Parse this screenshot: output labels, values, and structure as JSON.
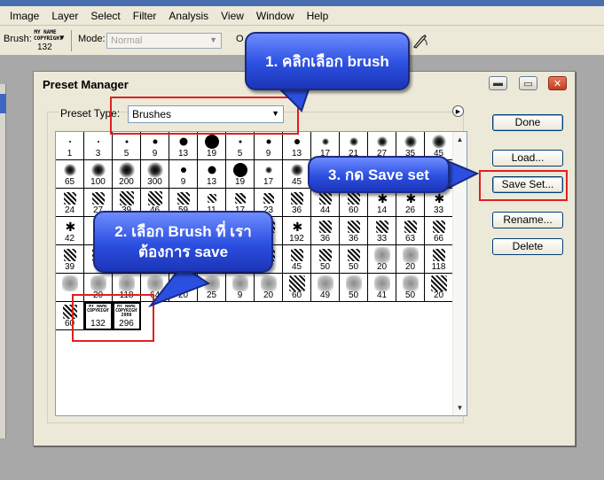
{
  "menubar": [
    "Image",
    "Layer",
    "Select",
    "Filter",
    "Analysis",
    "View",
    "Window",
    "Help"
  ],
  "options": {
    "brush_label": "Brush:",
    "brush_thumb_text": "MY NAME COPYRIGHT",
    "brush_size": "132",
    "mode_label": "Mode:",
    "mode_value": "Normal",
    "opacity_label_partial": "O"
  },
  "dialog": {
    "title": "Preset Manager",
    "preset_type_label": "Preset Type:",
    "preset_type_value": "Brushes",
    "buttons": {
      "done": "Done",
      "load": "Load...",
      "save_set": "Save Set...",
      "rename": "Rename...",
      "delete": "Delete"
    }
  },
  "brushes": [
    {
      "s": "1",
      "k": "hard",
      "d": 2
    },
    {
      "s": "3",
      "k": "hard",
      "d": 2
    },
    {
      "s": "5",
      "k": "hard",
      "d": 3
    },
    {
      "s": "9",
      "k": "hard",
      "d": 5
    },
    {
      "s": "13",
      "k": "hard",
      "d": 9
    },
    {
      "s": "19",
      "k": "hard",
      "d": 16
    },
    {
      "s": "5",
      "k": "hard",
      "d": 3
    },
    {
      "s": "9",
      "k": "hard",
      "d": 5
    },
    {
      "s": "13",
      "k": "hard",
      "d": 6
    },
    {
      "s": "17",
      "k": "soft",
      "d": 8
    },
    {
      "s": "21",
      "k": "soft",
      "d": 10
    },
    {
      "s": "27",
      "k": "soft",
      "d": 12
    },
    {
      "s": "35",
      "k": "soft",
      "d": 14
    },
    {
      "s": "45",
      "k": "soft",
      "d": 16
    },
    {
      "s": "65",
      "k": "soft",
      "d": 14
    },
    {
      "s": "100",
      "k": "soft",
      "d": 16
    },
    {
      "s": "200",
      "k": "soft",
      "d": 18
    },
    {
      "s": "300",
      "k": "soft",
      "d": 18
    },
    {
      "s": "9",
      "k": "hard",
      "d": 6
    },
    {
      "s": "13",
      "k": "hard",
      "d": 9
    },
    {
      "s": "19",
      "k": "hard",
      "d": 16
    },
    {
      "s": "17",
      "k": "soft",
      "d": 8
    },
    {
      "s": "45",
      "k": "soft",
      "d": 14
    },
    {
      "s": "",
      "k": "soft",
      "d": 14
    },
    {
      "s": "",
      "k": "soft",
      "d": 14
    },
    {
      "s": "",
      "k": "soft",
      "d": 14
    },
    {
      "s": "",
      "k": "soft",
      "d": 14
    },
    {
      "s": "",
      "k": "soft",
      "d": 14
    },
    {
      "s": "24",
      "k": "scatter",
      "d": 14
    },
    {
      "s": "27",
      "k": "scatter",
      "d": 14
    },
    {
      "s": "39",
      "k": "scatter",
      "d": 16
    },
    {
      "s": "46",
      "k": "scatter",
      "d": 16
    },
    {
      "s": "59",
      "k": "scatter",
      "d": 14
    },
    {
      "s": "11",
      "k": "scatter",
      "d": 10
    },
    {
      "s": "17",
      "k": "scatter",
      "d": 12
    },
    {
      "s": "23",
      "k": "scatter",
      "d": 12
    },
    {
      "s": "36",
      "k": "scatter",
      "d": 14
    },
    {
      "s": "44",
      "k": "scatter",
      "d": 14
    },
    {
      "s": "60",
      "k": "scatter",
      "d": 14
    },
    {
      "s": "14",
      "k": "star",
      "d": 10
    },
    {
      "s": "26",
      "k": "star",
      "d": 10
    },
    {
      "s": "33",
      "k": "star",
      "d": 10
    },
    {
      "s": "42",
      "k": "star",
      "d": 10
    },
    {
      "s": "",
      "k": "star",
      "d": 10
    },
    {
      "s": "",
      "k": "scatter",
      "d": 14
    },
    {
      "s": "",
      "k": "scatter",
      "d": 14
    },
    {
      "s": "",
      "k": "scatter",
      "d": 14
    },
    {
      "s": "",
      "k": "scatter",
      "d": 14
    },
    {
      "s": "",
      "k": "scatter",
      "d": 14
    },
    {
      "s": "",
      "k": "scatter",
      "d": 14
    },
    {
      "s": "192",
      "k": "star",
      "d": 12
    },
    {
      "s": "36",
      "k": "scatter",
      "d": 14
    },
    {
      "s": "36",
      "k": "scatter",
      "d": 14
    },
    {
      "s": "33",
      "k": "scatter",
      "d": 14
    },
    {
      "s": "63",
      "k": "scatter",
      "d": 14
    },
    {
      "s": "66",
      "k": "scatter",
      "d": 14
    },
    {
      "s": "39",
      "k": "scatter",
      "d": 14
    },
    {
      "s": "",
      "k": "scatter",
      "d": 14
    },
    {
      "s": "",
      "k": "scatter",
      "d": 14
    },
    {
      "s": "",
      "k": "scatter",
      "d": 14
    },
    {
      "s": "",
      "k": "scatter",
      "d": 14
    },
    {
      "s": "",
      "k": "scatter",
      "d": 14
    },
    {
      "s": "",
      "k": "scatter",
      "d": 14
    },
    {
      "s": "",
      "k": "scatter",
      "d": 14
    },
    {
      "s": "45",
      "k": "scatter",
      "d": 14
    },
    {
      "s": "50",
      "k": "scatter",
      "d": 14
    },
    {
      "s": "50",
      "k": "scatter",
      "d": 14
    },
    {
      "s": "20",
      "k": "grey",
      "d": 18
    },
    {
      "s": "20",
      "k": "grey",
      "d": 18
    },
    {
      "s": "118",
      "k": "scatter",
      "d": 14
    },
    {
      "s": "",
      "k": "grey",
      "d": 18
    },
    {
      "s": "20",
      "k": "grey",
      "d": 18
    },
    {
      "s": "118",
      "k": "grey",
      "d": 18
    },
    {
      "s": "64",
      "k": "grey",
      "d": 18
    },
    {
      "s": "20",
      "k": "grey",
      "d": 18
    },
    {
      "s": "25",
      "k": "grey",
      "d": 18
    },
    {
      "s": "9",
      "k": "grey",
      "d": 18
    },
    {
      "s": "20",
      "k": "grey",
      "d": 18
    },
    {
      "s": "60",
      "k": "scatter",
      "d": 18
    },
    {
      "s": "49",
      "k": "grey",
      "d": 18
    },
    {
      "s": "50",
      "k": "grey",
      "d": 18
    },
    {
      "s": "41",
      "k": "grey",
      "d": 18
    },
    {
      "s": "50",
      "k": "grey",
      "d": 18
    },
    {
      "s": "20",
      "k": "scatter",
      "d": 18
    },
    {
      "s": "60",
      "k": "scatter",
      "d": 16
    },
    {
      "s": "132",
      "k": "stamp",
      "d": 0,
      "text": "MY NAME COPYRIGHT"
    },
    {
      "s": "296",
      "k": "stamp",
      "d": 0,
      "text": "MY NAME COPYRIGHT 2008"
    }
  ],
  "callouts": {
    "step1": "1. คลิกเลือก brush",
    "step2": "2. เลือก Brush ที่ เราต้องการ save",
    "step3": "3. กด Save set"
  },
  "colors": {
    "callout_blue": "#2b4fe0",
    "highlight_red": "#e02020"
  }
}
